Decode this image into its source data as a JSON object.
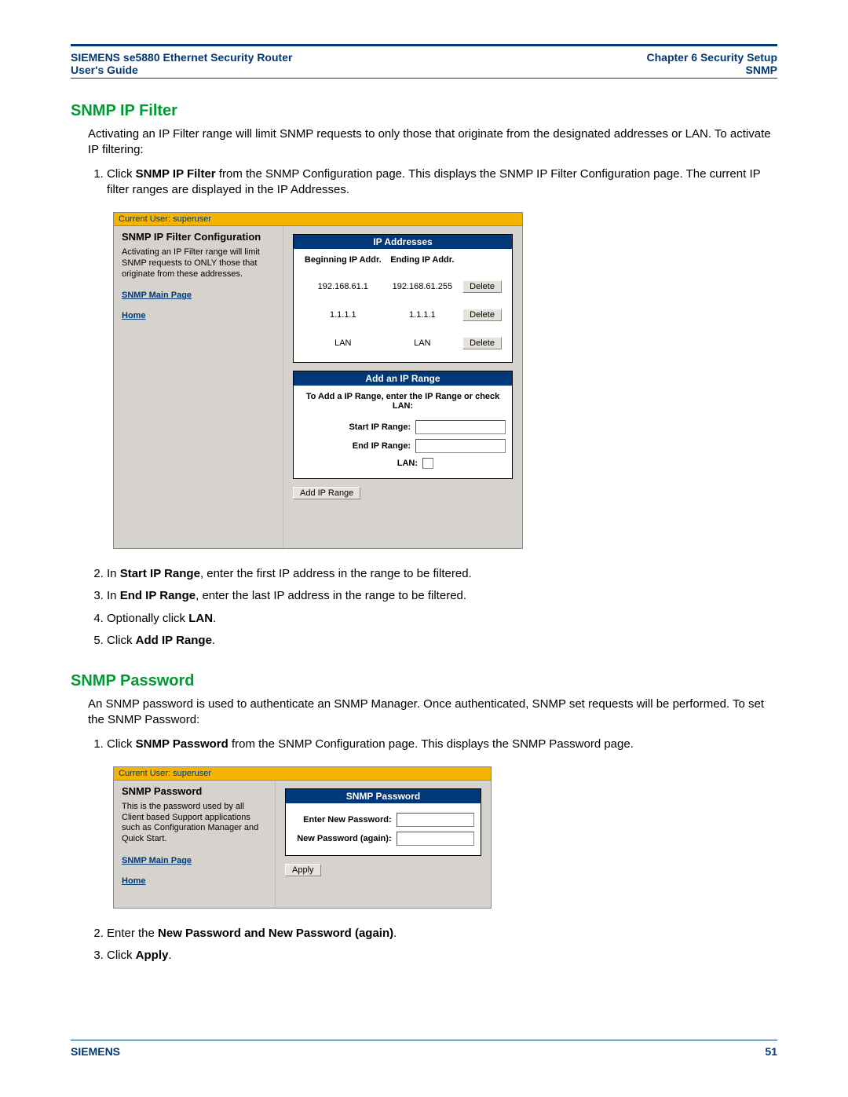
{
  "header": {
    "left1": "SIEMENS se5880 Ethernet Security Router",
    "left2": "User's Guide",
    "right1": "Chapter 6  Security Setup",
    "right2": "SNMP"
  },
  "footer": {
    "left": "SIEMENS",
    "right": "51"
  },
  "sec1": {
    "title": "SNMP IP Filter",
    "intro": "Activating an IP Filter range will limit SNMP requests to only those that originate from the designated addresses or LAN. To activate IP filtering:",
    "step1_pre": "Click ",
    "step1_b": "SNMP IP Filter",
    "step1_post": " from the SNMP Configuration page. This displays the SNMP IP Filter Configuration page. The current IP filter ranges are displayed in the IP Addresses.",
    "step2_pre": "In ",
    "step2_b": "Start IP Range",
    "step2_post": ", enter the first IP address in the range to be filtered.",
    "step3_pre": "In ",
    "step3_b": "End IP Range",
    "step3_post": ", enter the last IP address in the range to be filtered.",
    "step4_pre": "Optionally click ",
    "step4_b": "LAN",
    "step4_post": ".",
    "step5_pre": "Click ",
    "step5_b": "Add IP Range",
    "step5_post": "."
  },
  "shot1": {
    "goldbar": "Current User: superuser",
    "side_title": "SNMP IP Filter Configuration",
    "side_text": "Activating an IP Filter range will limit SNMP requests to ONLY those that originate from these addresses.",
    "link_main": "SNMP Main Page",
    "link_home": "Home",
    "box_ip_title": "IP Addresses",
    "col_begin": "Beginning IP Addr.",
    "col_end": "Ending IP Addr.",
    "rows": [
      {
        "begin": "192.168.61.1",
        "end": "192.168.61.255",
        "btn": "Delete"
      },
      {
        "begin": "1.1.1.1",
        "end": "1.1.1.1",
        "btn": "Delete"
      },
      {
        "begin": "LAN",
        "end": "LAN",
        "btn": "Delete"
      }
    ],
    "box_add_title": "Add an IP Range",
    "add_note": "To Add a IP Range, enter the IP Range or check LAN:",
    "lbl_start": "Start IP Range:",
    "lbl_end": "End IP Range:",
    "lbl_lan": "LAN:",
    "btn_add": "Add IP Range"
  },
  "sec2": {
    "title": "SNMP Password",
    "intro": "An SNMP password is used to authenticate an SNMP Manager. Once authenticated, SNMP set requests will be performed. To set the SNMP Password:",
    "step1_pre": "Click ",
    "step1_b": "SNMP Password",
    "step1_post": " from the SNMP Configuration page. This displays the SNMP Password page.",
    "step2_pre": "Enter the ",
    "step2_b": "New Password and New Password (again)",
    "step2_post": ".",
    "step3_pre": "Click ",
    "step3_b": "Apply",
    "step3_post": "."
  },
  "shot2": {
    "goldbar": "Current User: superuser",
    "side_title": "SNMP Password",
    "side_text": "This is the password used by all Client based Support applications such as Configuration Manager and Quick Start.",
    "link_main": "SNMP Main Page",
    "link_home": "Home",
    "box_title": "SNMP Password",
    "lbl_new": "Enter New Password:",
    "lbl_again": "New Password (again):",
    "btn_apply": "Apply"
  }
}
